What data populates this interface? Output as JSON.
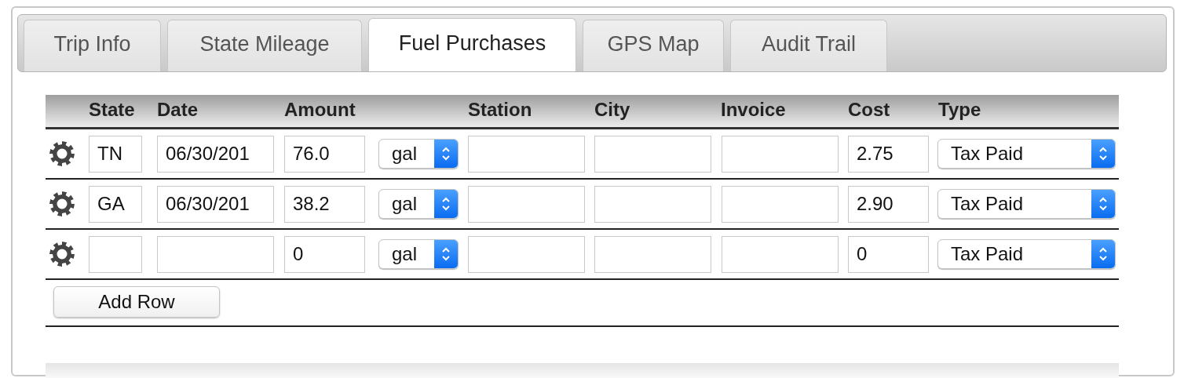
{
  "tabs": [
    {
      "label": "Trip Info",
      "selected": false
    },
    {
      "label": "State Mileage",
      "selected": false
    },
    {
      "label": "Fuel Purchases",
      "selected": true
    },
    {
      "label": "GPS Map",
      "selected": false
    },
    {
      "label": "Audit Trail",
      "selected": false
    }
  ],
  "table": {
    "columns": [
      "State",
      "Date",
      "Amount",
      "Station",
      "City",
      "Invoice",
      "Cost",
      "Type"
    ],
    "rows": [
      {
        "state": "TN",
        "date": "06/30/201",
        "amount": "76.0",
        "unit": "gal",
        "cost": "2.75",
        "type": "Tax Paid"
      },
      {
        "state": "GA",
        "date": "06/30/201",
        "amount": "38.2",
        "unit": "gal",
        "cost": "2.90",
        "type": "Tax Paid"
      },
      {
        "amount": "0",
        "unit": "gal",
        "cost": "0",
        "type": "Tax Paid"
      }
    ]
  },
  "add_button": "Add Row"
}
